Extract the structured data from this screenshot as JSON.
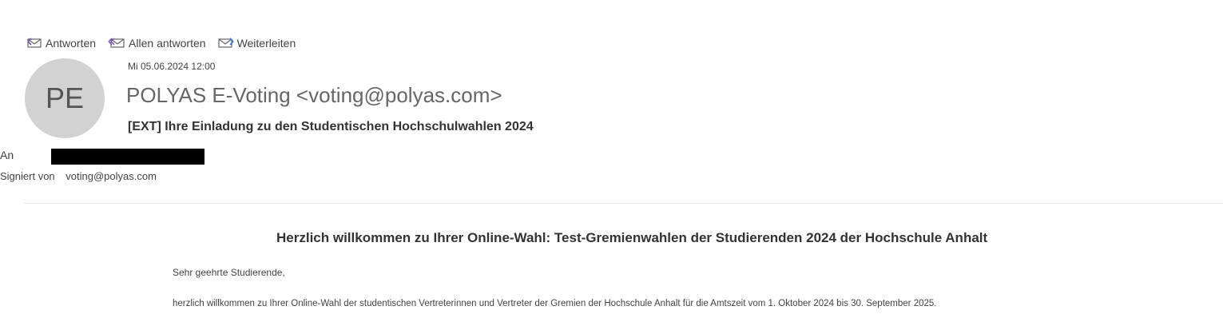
{
  "toolbar": {
    "reply_label": "Antworten",
    "reply_all_label": "Allen antworten",
    "forward_label": "Weiterleiten",
    "reply_icon": "reply-icon",
    "reply_all_icon": "reply-all-icon",
    "forward_icon": "forward-icon"
  },
  "message": {
    "avatar_initials": "PE",
    "date": "Mi 05.06.2024 12:00",
    "sender": "POLYAS E-Voting <voting@polyas.com>",
    "subject": "[EXT] Ihre Einladung zu den Studentischen Hochschulwahlen 2024",
    "to_label": "An",
    "signed_label": "Signiert von",
    "signed_value": "voting@polyas.com"
  },
  "body": {
    "heading": "Herzlich willkommen zu Ihrer Online-Wahl: Test-Gremienwahlen der Studierenden 2024 der Hochschule Anhalt",
    "greeting": "Sehr geehrte Studierende,",
    "paragraph": "herzlich willkommen zu Ihrer Online-Wahl der studentischen Vertreterinnen und Vertreter der Gremien der Hochschule Anhalt für die Amtszeit vom 1. Oktober 2024 bis 30. September 2025."
  },
  "colors": {
    "avatar_bg": "#d2d2d2",
    "accent_reply": "#7a4fb5",
    "accent_forward": "#3a7bd5"
  }
}
